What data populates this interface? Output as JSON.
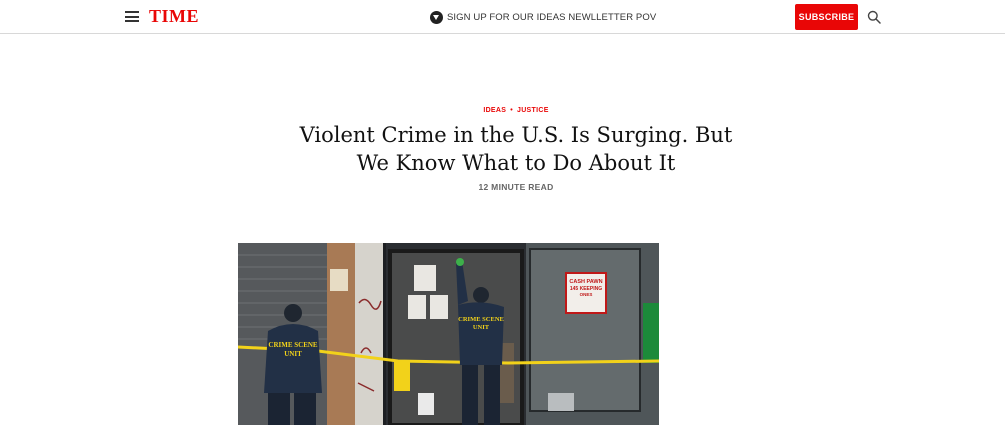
{
  "header": {
    "logo": "TIME",
    "newsletter_label": "SIGN UP FOR OUR IDEAS NEWLLETTER POV",
    "subscribe_label": "SUBSCRIBE",
    "icons": [
      "menu-icon",
      "newsletter-icon",
      "search-icon"
    ]
  },
  "article": {
    "kicker_section": "IDEAS",
    "kicker_separator": "•",
    "kicker_topic": "JUSTICE",
    "headline": "Violent Crime in the U.S. Is Surging. But We Know What to Do About It",
    "read_time": "12 MINUTE READ"
  },
  "hero_image": {
    "jacket_text_left": [
      "CRIME SCENE",
      "UNIT"
    ],
    "jacket_text_right": [
      "CRIME SCENE",
      "UNIT"
    ],
    "window_sign": [
      "CASH PAWN",
      "145 KEEPING",
      "ONES"
    ]
  },
  "colors": {
    "brand": "#e90606",
    "tape": "#f2d21a"
  }
}
